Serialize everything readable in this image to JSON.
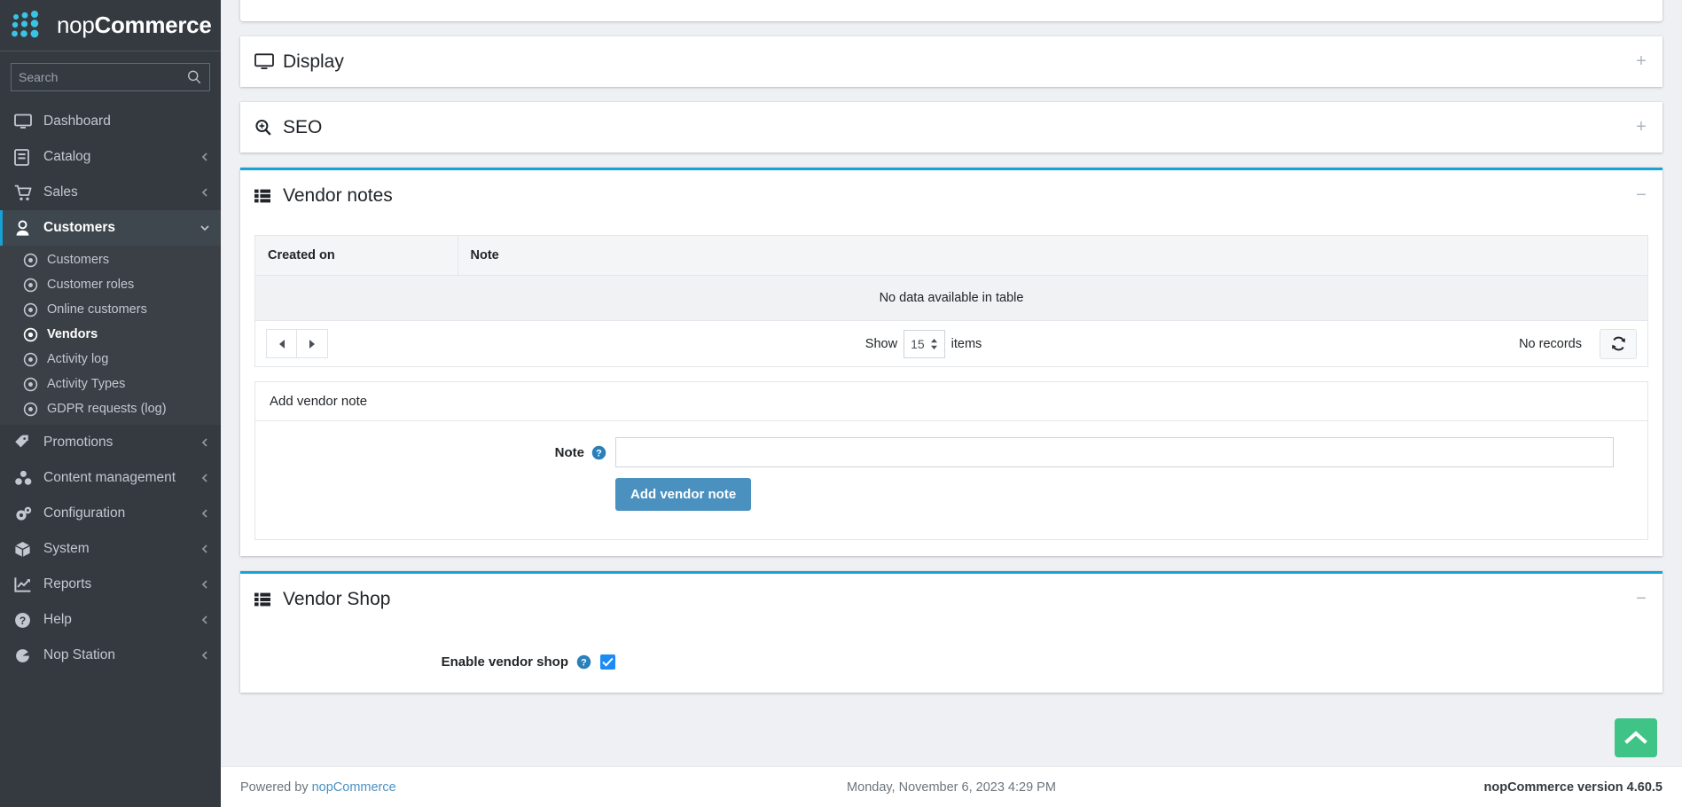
{
  "brand": {
    "light": "nop",
    "bold": "Commerce"
  },
  "search": {
    "placeholder": "Search",
    "value": "",
    "icon": "search-icon"
  },
  "sidebar": {
    "items": [
      {
        "label": "Dashboard",
        "icon": "dashboard-icon",
        "caret": false,
        "active": false
      },
      {
        "label": "Catalog",
        "icon": "catalog-icon",
        "caret": "left",
        "active": false
      },
      {
        "label": "Sales",
        "icon": "sales-cart-icon",
        "caret": "left",
        "active": false
      },
      {
        "label": "Customers",
        "icon": "customers-user-icon",
        "caret": "down",
        "active": true
      }
    ],
    "sub_items": [
      {
        "label": "Customers",
        "current": false
      },
      {
        "label": "Customer roles",
        "current": false
      },
      {
        "label": "Online customers",
        "current": false
      },
      {
        "label": "Vendors",
        "current": true
      },
      {
        "label": "Activity log",
        "current": false
      },
      {
        "label": "Activity Types",
        "current": false
      },
      {
        "label": "GDPR requests (log)",
        "current": false
      }
    ],
    "items_after": [
      {
        "label": "Promotions",
        "icon": "promotions-tag-icon",
        "caret": "left"
      },
      {
        "label": "Content management",
        "icon": "content-management-icon",
        "caret": "left"
      },
      {
        "label": "Configuration",
        "icon": "configuration-gears-icon",
        "caret": "left"
      },
      {
        "label": "System",
        "icon": "system-box-icon",
        "caret": "left"
      },
      {
        "label": "Reports",
        "icon": "reports-chart-icon",
        "caret": "left"
      },
      {
        "label": "Help",
        "icon": "help-question-icon",
        "caret": "left"
      },
      {
        "label": "Nop Station",
        "icon": "nop-station-icon",
        "caret": "left"
      }
    ]
  },
  "panels": {
    "display": {
      "title": "Display",
      "icon": "display-monitor-icon",
      "toggle": "+"
    },
    "seo": {
      "title": "SEO",
      "icon": "seo-magnifier-plus-icon",
      "toggle": "+"
    },
    "vendor_notes": {
      "title": "Vendor notes",
      "icon": "list-grid-icon",
      "toggle": "−"
    },
    "vendor_shop": {
      "title": "Vendor Shop",
      "icon": "list-grid-icon",
      "toggle": "−"
    }
  },
  "vendor_notes_grid": {
    "columns": [
      "Created on",
      "Note"
    ],
    "rows": [],
    "empty_text": "No data available in table",
    "pager": {
      "prev_icon": "previous-page-icon",
      "next_icon": "next-page-icon",
      "show_label": "Show",
      "page_size": "15",
      "items_label": "items",
      "records_text": "No records",
      "refresh_icon": "refresh-icon"
    }
  },
  "add_vendor_note": {
    "section_title": "Add vendor note",
    "note_label": "Note",
    "note_value": "",
    "note_placeholder": "",
    "help_icon": "help-circle-icon",
    "button_label": "Add vendor note"
  },
  "vendor_shop": {
    "enable_label": "Enable vendor shop",
    "help_icon": "help-circle-icon",
    "enabled": true
  },
  "footer": {
    "powered_prefix": "Powered by ",
    "powered_link": "nopCommerce",
    "datetime": "Monday, November 6, 2023 4:29 PM",
    "version": "nopCommerce version 4.60.5"
  },
  "scroll_top": {
    "icon": "chevron-up-icon"
  },
  "colors": {
    "sidebar_bg": "#343a40",
    "accent": "#17a2d8",
    "primary_button": "#4b91bf",
    "scroll_top": "#3fc387",
    "checkbox": "#1b8cf5",
    "logo_dots": "#3bc3e3"
  }
}
